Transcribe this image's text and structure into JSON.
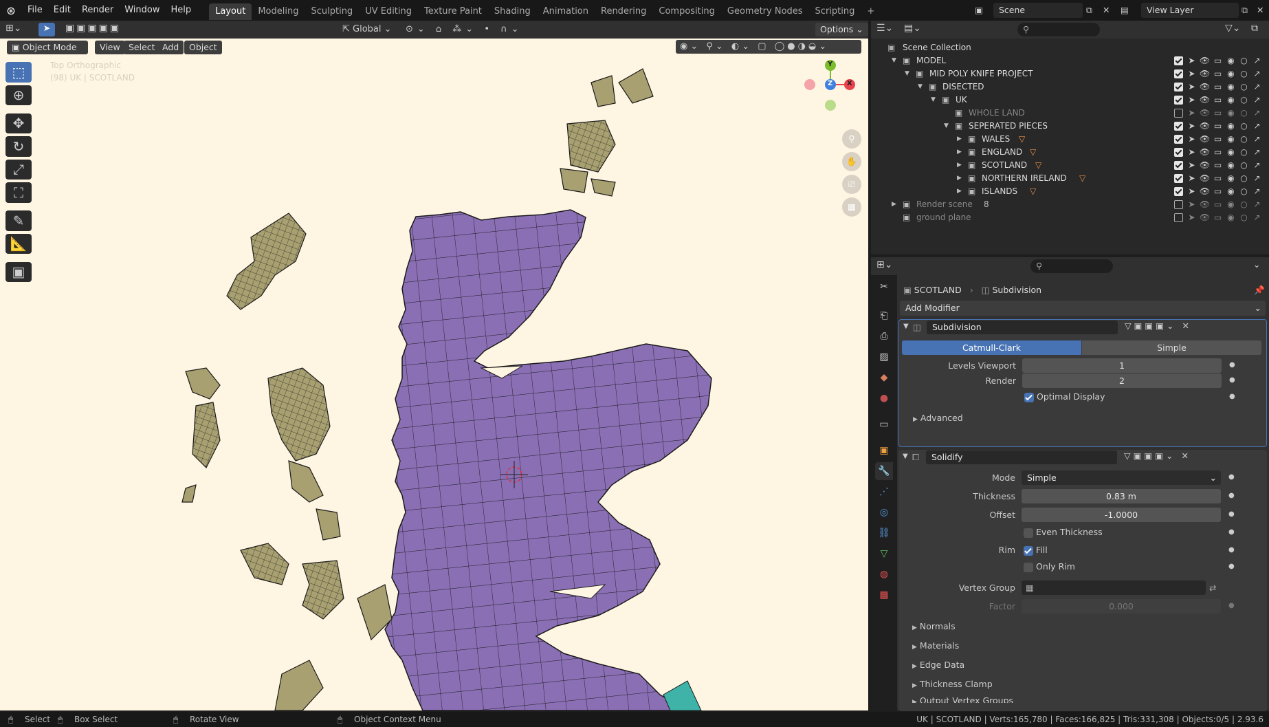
{
  "topbar": {
    "menus": [
      "File",
      "Edit",
      "Render",
      "Window",
      "Help"
    ],
    "workspaces": [
      "Layout",
      "Modeling",
      "Sculpting",
      "UV Editing",
      "Texture Paint",
      "Shading",
      "Animation",
      "Rendering",
      "Compositing",
      "Geometry Nodes",
      "Scripting"
    ],
    "active_workspace": "Layout",
    "add_tab": "+",
    "scene": "Scene",
    "view_layer": "View Layer"
  },
  "viewport": {
    "header": {
      "transform_orientation": "Global",
      "options": "Options"
    },
    "header2": {
      "mode": "Object Mode",
      "view": "View",
      "select": "Select",
      "add": "Add",
      "object": "Object"
    },
    "overlay_text": {
      "view_name": "Top Orthographic",
      "object_info": "(98) UK | SCOTLAND"
    },
    "gizmo": {
      "x": "X",
      "y": "Y",
      "z": "Z"
    },
    "colors": {
      "background": "#fff5e3",
      "land": "#8a6fb5",
      "islands": "#a8a070",
      "wire": "#1a1a1a"
    }
  },
  "outliner": {
    "root": "Scene Collection",
    "rows": [
      {
        "label": "MODEL",
        "indent": 0
      },
      {
        "label": "MID POLY KNIFE PROJECT",
        "indent": 1
      },
      {
        "label": "DISECTED",
        "indent": 2
      },
      {
        "label": "UK",
        "indent": 3
      },
      {
        "label": "WHOLE LAND",
        "indent": 4
      },
      {
        "label": "SEPERATED PIECES",
        "indent": 4
      },
      {
        "label": "WALES",
        "indent": 5
      },
      {
        "label": "ENGLAND",
        "indent": 5
      },
      {
        "label": "SCOTLAND",
        "indent": 5
      },
      {
        "label": "NORTHERN IRELAND",
        "indent": 5
      },
      {
        "label": "ISLANDS",
        "indent": 5
      },
      {
        "label": "Render scene",
        "indent": 0
      },
      {
        "label": "ground plane",
        "indent": 0
      }
    ],
    "render_scene_count": "8"
  },
  "properties": {
    "breadcrumb_object": "SCOTLAND",
    "breadcrumb_modifier": "Subdivision",
    "add_modifier": "Add Modifier",
    "subdivision": {
      "name": "Subdivision",
      "tab_catmull": "Catmull-Clark",
      "tab_simple": "Simple",
      "levels_viewport_label": "Levels Viewport",
      "levels_viewport": "1",
      "render_label": "Render",
      "render": "2",
      "optimal_display": "Optimal Display",
      "advanced": "Advanced"
    },
    "solidify": {
      "name": "Solidify",
      "mode_label": "Mode",
      "mode": "Simple",
      "thickness_label": "Thickness",
      "thickness": "0.83 m",
      "offset_label": "Offset",
      "offset": "-1.0000",
      "even_thickness": "Even Thickness",
      "rim_label": "Rim",
      "fill": "Fill",
      "only_rim": "Only Rim",
      "vertex_group_label": "Vertex Group",
      "factor_label": "Factor",
      "factor": "0.000",
      "sections": [
        "Normals",
        "Materials",
        "Edge Data",
        "Thickness Clamp",
        "Output Vertex Groups"
      ]
    }
  },
  "statusbar": {
    "select": "Select",
    "box_select": "Box Select",
    "rotate_view": "Rotate View",
    "context_menu": "Object Context Menu",
    "stats": "UK | SCOTLAND | Verts:165,780 | Faces:166,825 | Tris:331,308 | Objects:0/5 | 2.93.6"
  }
}
